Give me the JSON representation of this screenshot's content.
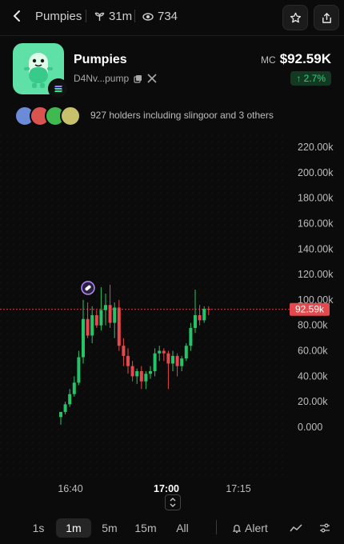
{
  "header": {
    "title": "Pumpies",
    "age": "31m",
    "views": "734"
  },
  "token": {
    "name": "Pumpies",
    "address": "D4Nv...pump",
    "mc_label": "MC",
    "mc_value": "$92.59K",
    "change": "↑ 2.7%",
    "holders_text": "927 holders including slingoor and 3 others"
  },
  "chart_data": {
    "type": "candlestick",
    "yticks": [
      "220.00k",
      "200.00k",
      "180.00k",
      "160.00k",
      "140.00k",
      "120.00k",
      "100.00k",
      "80.00k",
      "60.00k",
      "40.00k",
      "20.00k",
      "0.000"
    ],
    "xticks": [
      "16:40",
      "17:00",
      "17:15"
    ],
    "current_price_label": "92.59k",
    "current_price": 92.59,
    "ylim": [
      0,
      220
    ],
    "candles": [
      {
        "o": 8,
        "h": 12,
        "l": 2,
        "c": 12
      },
      {
        "o": 12,
        "h": 20,
        "l": 10,
        "c": 18
      },
      {
        "o": 18,
        "h": 30,
        "l": 16,
        "c": 26
      },
      {
        "o": 26,
        "h": 40,
        "l": 24,
        "c": 35
      },
      {
        "o": 35,
        "h": 60,
        "l": 33,
        "c": 55
      },
      {
        "o": 55,
        "h": 100,
        "l": 50,
        "c": 85
      },
      {
        "o": 85,
        "h": 98,
        "l": 70,
        "c": 72
      },
      {
        "o": 72,
        "h": 95,
        "l": 66,
        "c": 88
      },
      {
        "o": 88,
        "h": 92,
        "l": 78,
        "c": 80
      },
      {
        "o": 80,
        "h": 110,
        "l": 76,
        "c": 92
      },
      {
        "o": 92,
        "h": 105,
        "l": 80,
        "c": 96
      },
      {
        "o": 96,
        "h": 112,
        "l": 78,
        "c": 82
      },
      {
        "o": 82,
        "h": 98,
        "l": 70,
        "c": 94
      },
      {
        "o": 94,
        "h": 100,
        "l": 60,
        "c": 64
      },
      {
        "o": 64,
        "h": 70,
        "l": 48,
        "c": 56
      },
      {
        "o": 56,
        "h": 62,
        "l": 42,
        "c": 48
      },
      {
        "o": 48,
        "h": 52,
        "l": 36,
        "c": 40
      },
      {
        "o": 40,
        "h": 46,
        "l": 34,
        "c": 44
      },
      {
        "o": 44,
        "h": 48,
        "l": 30,
        "c": 36
      },
      {
        "o": 36,
        "h": 44,
        "l": 30,
        "c": 42
      },
      {
        "o": 42,
        "h": 48,
        "l": 38,
        "c": 44
      },
      {
        "o": 44,
        "h": 62,
        "l": 40,
        "c": 58
      },
      {
        "o": 58,
        "h": 64,
        "l": 52,
        "c": 60
      },
      {
        "o": 60,
        "h": 62,
        "l": 52,
        "c": 58
      },
      {
        "o": 58,
        "h": 60,
        "l": 30,
        "c": 50
      },
      {
        "o": 50,
        "h": 60,
        "l": 44,
        "c": 56
      },
      {
        "o": 56,
        "h": 58,
        "l": 40,
        "c": 48
      },
      {
        "o": 48,
        "h": 56,
        "l": 44,
        "c": 54
      },
      {
        "o": 54,
        "h": 66,
        "l": 52,
        "c": 64
      },
      {
        "o": 64,
        "h": 82,
        "l": 60,
        "c": 78
      },
      {
        "o": 78,
        "h": 108,
        "l": 74,
        "c": 88
      },
      {
        "o": 88,
        "h": 96,
        "l": 80,
        "c": 84
      },
      {
        "o": 84,
        "h": 95,
        "l": 82,
        "c": 93
      },
      {
        "o": 93,
        "h": 95,
        "l": 88,
        "c": 92.59
      }
    ],
    "colors": {
      "up": "#26c46a",
      "down": "#e5484d",
      "price_line": "#e5484d"
    }
  },
  "timeframes": [
    "1s",
    "1m",
    "5m",
    "15m",
    "All"
  ],
  "active_timeframe": "1m",
  "toolbar": {
    "alert_label": "Alert"
  }
}
